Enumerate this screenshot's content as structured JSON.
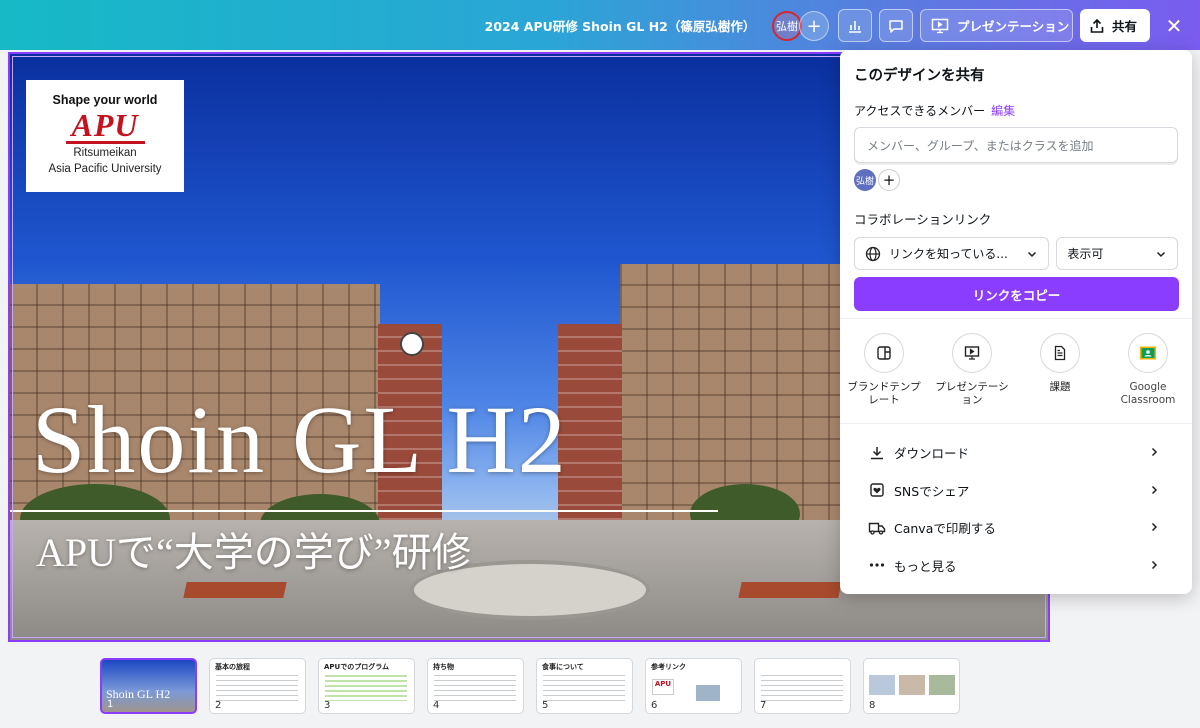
{
  "header": {
    "doc_title": "2024 APU研修 Shoin GL H2（篠原弘樹作）",
    "avatar_initials": "弘樹",
    "add_label": "+",
    "present_label": "プレゼンテーション",
    "share_label": "共有",
    "close_label": "✕"
  },
  "slide": {
    "logo_tagline": "Shape your world",
    "logo_mark": "APU",
    "logo_sub1": "Ritsumeikan",
    "logo_sub2": "Asia Pacific University",
    "title": "Shoin GL H2",
    "subtitle": "APUで“大学の学び”研修"
  },
  "share_panel": {
    "heading": "このデザインを共有",
    "access_label": "アクセスできるメンバー",
    "edit_label": "編集",
    "member_placeholder": "メンバー、グループ、またはクラスを追加",
    "member_initials": "弘樹",
    "collab_label": "コラボレーションリンク",
    "link_scope": "リンクを知っている...",
    "permission": "表示可",
    "copy_button": "リンクをコピー",
    "options": [
      {
        "label": "ブランドテンプレート",
        "icon": "brand-template-icon"
      },
      {
        "label": "プレゼンテーション",
        "icon": "presentation-icon"
      },
      {
        "label": "課題",
        "icon": "assignment-icon"
      },
      {
        "label": "Google Classroom",
        "icon": "google-classroom-icon"
      }
    ],
    "menu": [
      {
        "label": "ダウンロード",
        "icon": "download-icon"
      },
      {
        "label": "SNSでシェア",
        "icon": "social-share-icon"
      },
      {
        "label": "Canvaで印刷する",
        "icon": "print-truck-icon"
      },
      {
        "label": "もっと見る",
        "icon": "more-icon"
      }
    ]
  },
  "thumbnails": [
    {
      "num": "1",
      "title": "Shoin GL H2"
    },
    {
      "num": "2",
      "title": "基本の旅程"
    },
    {
      "num": "3",
      "title": "APUでのプログラム"
    },
    {
      "num": "4",
      "title": "持ち物"
    },
    {
      "num": "5",
      "title": "食事について"
    },
    {
      "num": "6",
      "title": "参考リンク"
    },
    {
      "num": "7",
      "title": ""
    },
    {
      "num": "8",
      "title": ""
    }
  ],
  "colors": {
    "accent": "#8b3dff",
    "apu_red": "#c4121f"
  }
}
